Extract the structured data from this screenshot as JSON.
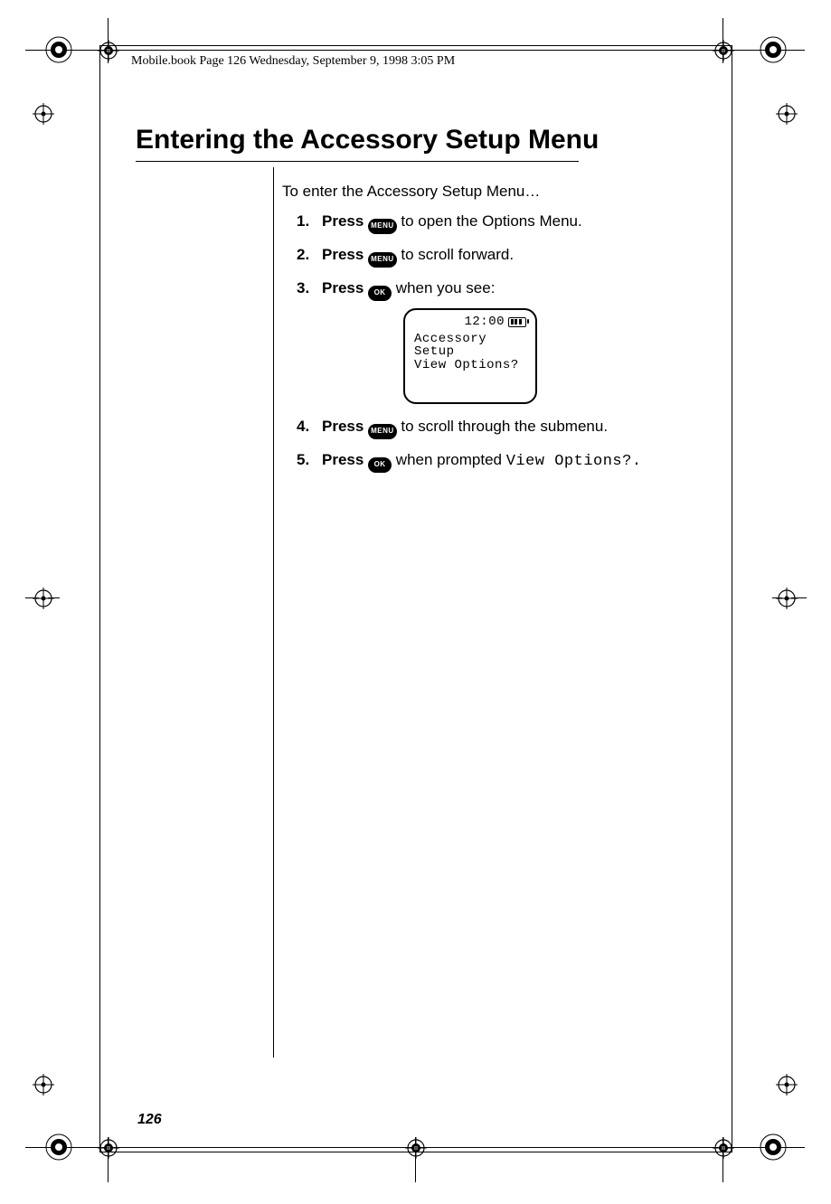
{
  "running_header": "Mobile.book  Page 126  Wednesday, September 9, 1998  3:05 PM",
  "title": "Entering the Accessory Setup Menu",
  "intro": "To enter the Accessory Setup Menu…",
  "keys": {
    "menu": "MENU",
    "ok": "OK"
  },
  "steps": {
    "s1": {
      "press": "Press",
      "after": " to open the Options Menu."
    },
    "s2": {
      "press": "Press",
      "after": " to scroll forward."
    },
    "s3": {
      "press": "Press",
      "after": " when you see:"
    },
    "s4": {
      "press": "Press",
      "after": " to scroll through the submenu."
    },
    "s5": {
      "press": "Press",
      "mid": " when prompted ",
      "prompt": "View Options?",
      "end": "."
    }
  },
  "screen": {
    "time": "12:00",
    "line1": "Accessory",
    "line2": "Setup",
    "line3": "View Options?"
  },
  "page_number": "126"
}
